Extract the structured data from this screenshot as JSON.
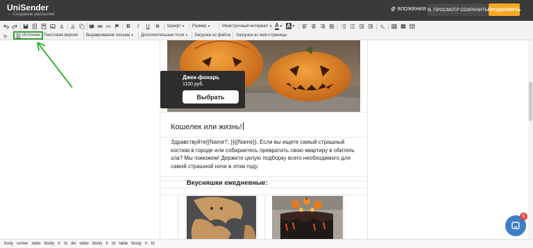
{
  "header": {
    "brand": "UniSender",
    "subtitle": "← Создание рассылки",
    "attachments_label": "ВЛОЖЕНИЯ",
    "preview_label": "ПРОСМОТР",
    "save_label": "СОХРАНИТЬ",
    "continue_label": "ПРОДОЛЖИТЬ"
  },
  "toolbar": {
    "font_label": "Шрифт",
    "size_label": "Размер",
    "line_spacing_label": "Межстрочный интервал",
    "text_color_label": "A",
    "bg_color_label": "A",
    "source_label": "Источник",
    "text_version_label": "Текстовая версия",
    "align_letter_label": "Выравнивание письма",
    "extra_fields_label": "Дополнительные поля",
    "upload_file_label": "Загрузка из файла",
    "upload_web_label": "Загрузка из web-страницы",
    "bold_label": "B",
    "italic_label": "I",
    "underline_label": "U",
    "strike_label": "S"
  },
  "email": {
    "product_name": "Джек-фонарь",
    "product_price": "1100 руб.",
    "choose_button": "Выбрать",
    "headline": "Кошелек или жизнь!",
    "paragraph": "Здравствуйте{{Name?, }}{{Name}}. Если вы ищете самый страшный костюм в городе или собираетесь превратить свою квартиру в обитель зла? Мы поможем! Держите целую подборку всего необходимого для самой страшной ночи в этом году.",
    "subheading": "Вкусняшки ежедневные:"
  },
  "pathbar": [
    "body",
    "center",
    "table",
    "tbody",
    "tr",
    "td",
    "div",
    "table",
    "tbody",
    "tr",
    "td",
    "table",
    "tbody",
    "tr",
    "td"
  ],
  "chat": {
    "badge_count": "5"
  },
  "colors": {
    "header_bg": "#3a3a3a",
    "continue_accent": "#f6a623",
    "highlight_green": "#2fa12f",
    "chat_blue": "#3b7fc4",
    "badge_red": "#e8423f"
  }
}
